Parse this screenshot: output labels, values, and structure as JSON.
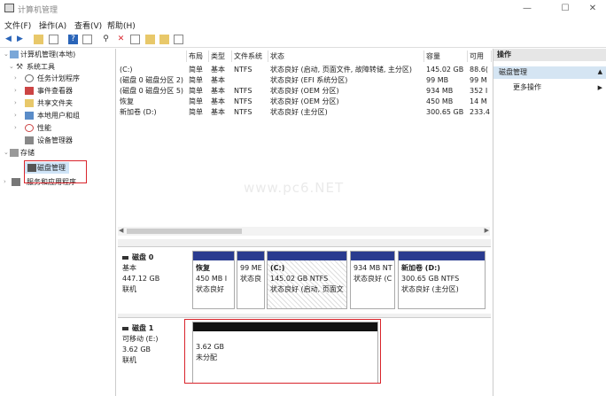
{
  "window": {
    "title": "计算机管理"
  },
  "menu": [
    "文件(F)",
    "操作(A)",
    "查看(V)",
    "帮助(H)"
  ],
  "tree": {
    "root": "计算机管理(本地)",
    "system_tools": "系统工具",
    "task_scheduler": "任务计划程序",
    "event_viewer": "事件查看器",
    "shared_folders": "共享文件夹",
    "local_users": "本地用户和组",
    "performance": "性能",
    "device_manager": "设备管理器",
    "storage": "存储",
    "disk_management": "磁盘管理",
    "services": "服务和应用程序"
  },
  "columns": [
    "布局",
    "类型",
    "文件系统",
    "状态",
    "容量",
    "可用"
  ],
  "volumes": [
    {
      "name": "(C:)",
      "layout": "简单",
      "type": "基本",
      "fs": "NTFS",
      "status": "状态良好 (启动, 页面文件, 故障转储, 主分区)",
      "capacity": "145.02 GB",
      "free": "88.6("
    },
    {
      "name": "(磁盘 0 磁盘分区 2)",
      "layout": "简单",
      "type": "基本",
      "fs": "",
      "status": "状态良好 (EFI 系统分区)",
      "capacity": "99 MB",
      "free": "99 M"
    },
    {
      "name": "(磁盘 0 磁盘分区 5)",
      "layout": "简单",
      "type": "基本",
      "fs": "NTFS",
      "status": "状态良好 (OEM 分区)",
      "capacity": "934 MB",
      "free": "352 I"
    },
    {
      "name": "恢复",
      "layout": "简单",
      "type": "基本",
      "fs": "NTFS",
      "status": "状态良好 (OEM 分区)",
      "capacity": "450 MB",
      "free": "14 M"
    },
    {
      "name": "新加卷 (D:)",
      "layout": "简单",
      "type": "基本",
      "fs": "NTFS",
      "status": "状态良好 (主分区)",
      "capacity": "300.65 GB",
      "free": "233.4"
    }
  ],
  "watermark": "www.pc6.NET",
  "disk0": {
    "title": "磁盘 0",
    "type": "基本",
    "size": "447.12 GB",
    "state": "联机",
    "partitions": [
      {
        "name": "恢复",
        "size": "450 MB I",
        "status": "状态良好"
      },
      {
        "name": "",
        "size": "99 ME",
        "status": "状态良"
      },
      {
        "name": "(C:)",
        "size": "145.02 GB NTFS",
        "status": "状态良好 (启动, 页面文"
      },
      {
        "name": "",
        "size": "934 MB NT",
        "status": "状态良好 (C"
      },
      {
        "name": "新加卷 (D:)",
        "size": "300.65 GB NTFS",
        "status": "状态良好 (主分区)"
      }
    ]
  },
  "disk1": {
    "title": "磁盘 1",
    "type": "可移动 (E:)",
    "size": "3.62 GB",
    "state": "联机",
    "unallocated": {
      "size": "3.62 GB",
      "label": "未分配"
    }
  },
  "actions": {
    "header": "操作",
    "section": "磁盘管理",
    "more": "更多操作"
  },
  "colors": {
    "primary_bar": "#2a3b8f",
    "unallocated_bar": "#111111",
    "highlight": "#d9242b",
    "selection": "#cfe4f7"
  }
}
